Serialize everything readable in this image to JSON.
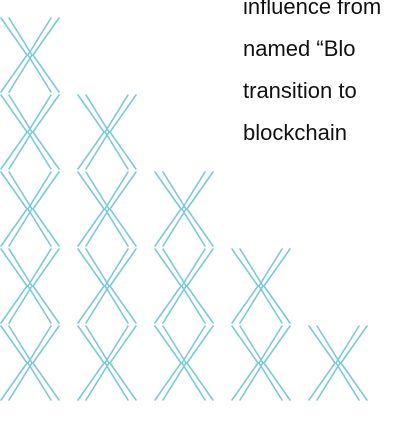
{
  "body_text": {
    "lines": [
      "influence from",
      "named “Blo",
      "transition to",
      "blockchain"
    ]
  },
  "decoration": {
    "motif": "x-chevron-icon",
    "stroke_color": "#7cc9da",
    "background": "#ffffff",
    "row_counts": [
      1,
      2,
      3,
      4,
      5
    ]
  }
}
